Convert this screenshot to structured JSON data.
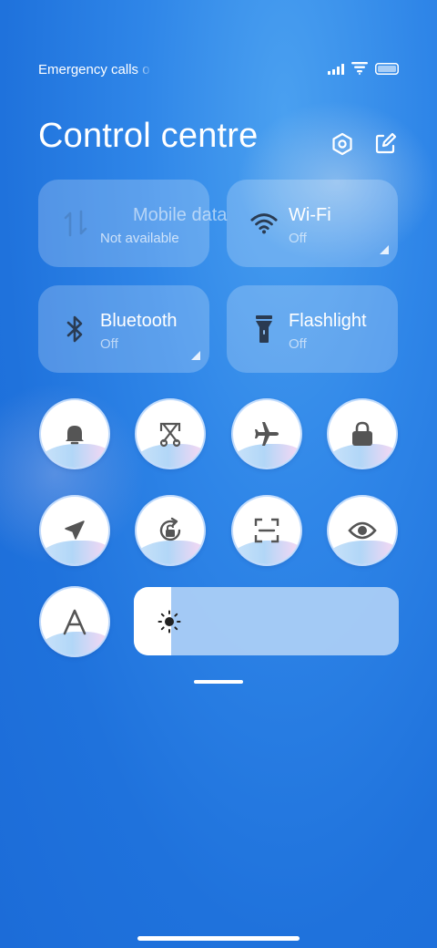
{
  "status_bar": {
    "text": "Emergency calls o",
    "icons": [
      "signal-icon",
      "wifi-icon",
      "battery-icon"
    ]
  },
  "header": {
    "title": "Control centre",
    "settings_icon": "settings-icon",
    "edit_icon": "edit-icon"
  },
  "tiles": {
    "mobile_data": {
      "label": "Mobile data",
      "status": "Not available",
      "icon": "mobile-data-icon"
    },
    "wifi": {
      "label": "Wi-Fi",
      "status": "Off",
      "icon": "wifi-icon"
    },
    "bluetooth": {
      "label": "Bluetooth",
      "status": "Off",
      "icon": "bluetooth-icon"
    },
    "flashlight": {
      "label": "Flashlight",
      "status": "Off",
      "icon": "flashlight-icon"
    }
  },
  "toggles": [
    {
      "name": "bell-icon"
    },
    {
      "name": "screenshot-icon"
    },
    {
      "name": "airplane-icon"
    },
    {
      "name": "lock-icon"
    },
    {
      "name": "location-icon"
    },
    {
      "name": "rotation-lock-icon"
    },
    {
      "name": "scan-icon"
    },
    {
      "name": "eye-icon"
    },
    {
      "name": "font-icon"
    }
  ],
  "brightness": {
    "level": 0.14,
    "icon": "brightness-icon"
  },
  "colors": {
    "background": "#2f86e8",
    "tile": "rgba(255,255,255,0.22)",
    "icon_dark": "#555555",
    "brightness_track": "#aacdf5"
  }
}
